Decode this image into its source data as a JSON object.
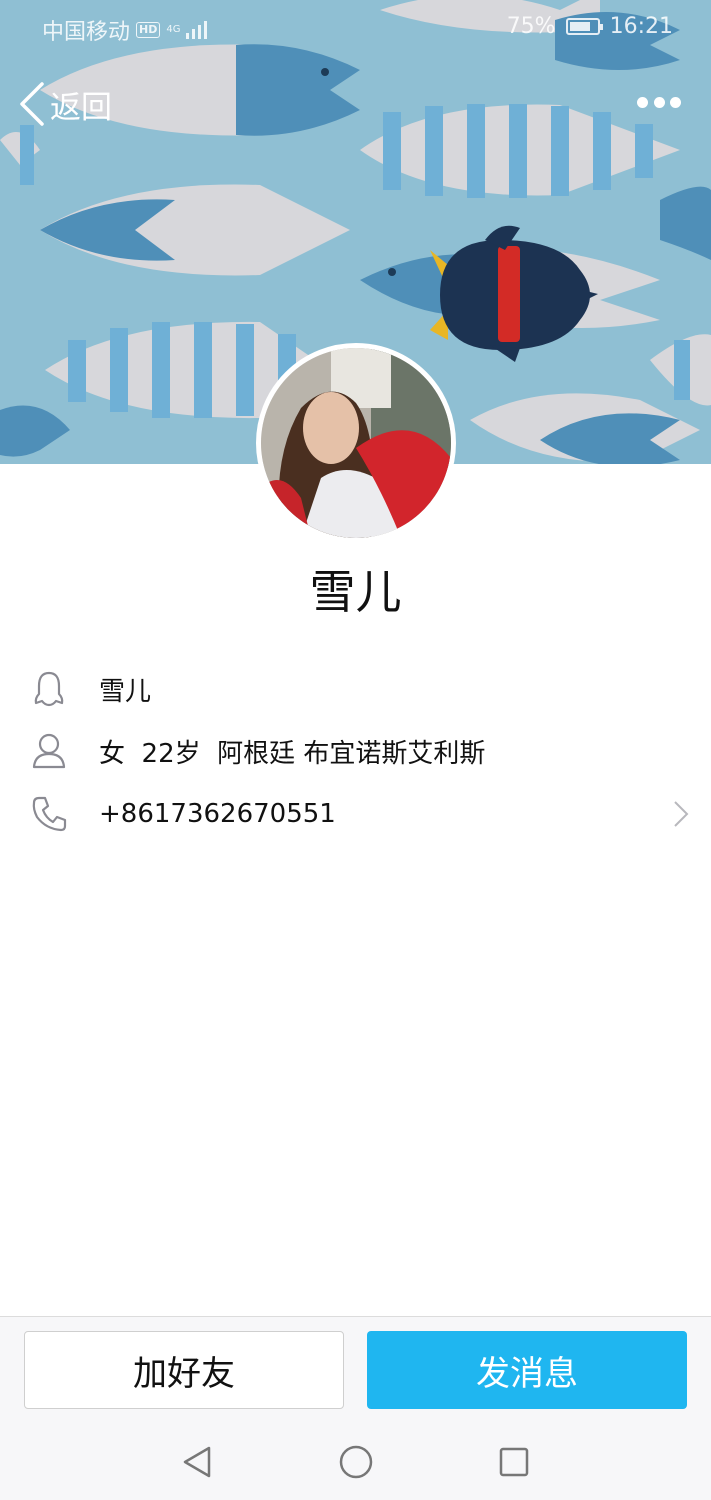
{
  "status_bar": {
    "carrier": "中国移动",
    "hd_badge": "HD",
    "network": "4G",
    "battery_percent": "75%",
    "battery_level": 0.75,
    "time": "16:21"
  },
  "nav": {
    "back_label": "返回",
    "more_icon": "more-dots-icon"
  },
  "profile": {
    "nickname": "雪儿",
    "qq_name": "雪儿",
    "gender": "女",
    "age": "22岁",
    "location": "阿根廷 布宜诺斯艾利斯",
    "phone": "+8617362670551"
  },
  "actions": {
    "add_friend_label": "加好友",
    "send_message_label": "发消息"
  },
  "colors": {
    "banner_bg": "#8fbfd3",
    "primary_button": "#1fb6f0",
    "icon_gray": "#8a8a92"
  }
}
